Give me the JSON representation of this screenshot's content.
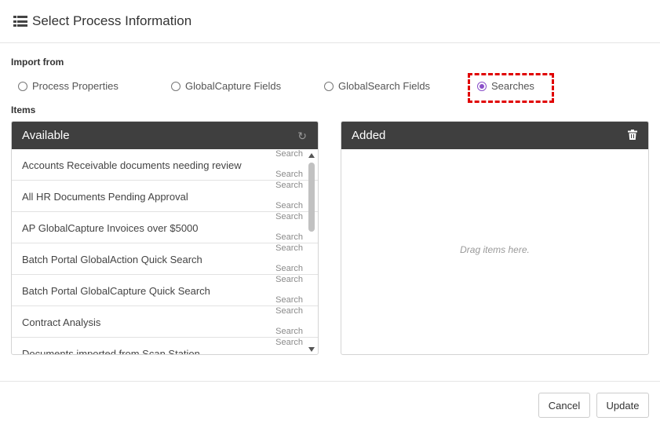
{
  "dialog": {
    "title": "Select Process Information",
    "icon": "list-icon"
  },
  "import_from": {
    "label": "Import from",
    "options": [
      {
        "label": "Process Properties",
        "selected": false
      },
      {
        "label": "GlobalCapture Fields",
        "selected": false
      },
      {
        "label": "GlobalSearch Fields",
        "selected": false
      },
      {
        "label": "Searches",
        "selected": true
      }
    ],
    "accent_color": "#8a4fc9",
    "highlight_color": "#e00000"
  },
  "items": {
    "label": "Items",
    "available": {
      "title": "Available",
      "tool_icon": "refresh-icon",
      "list": [
        {
          "name": "Accounts Receivable documents needing review",
          "type": "Search"
        },
        {
          "name": "All HR Documents Pending Approval",
          "type": "Search"
        },
        {
          "name": "AP GlobalCapture Invoices over $5000",
          "type": "Search"
        },
        {
          "name": "Batch Portal GlobalAction Quick Search",
          "type": "Search"
        },
        {
          "name": "Batch Portal GlobalCapture Quick Search",
          "type": "Search"
        },
        {
          "name": "Contract Analysis",
          "type": "Search"
        },
        {
          "name": "Documents imported from Scan Station",
          "type": "Search"
        }
      ]
    },
    "added": {
      "title": "Added",
      "tool_icon": "trash-icon",
      "empty_hint": "Drag items here."
    }
  },
  "footer": {
    "cancel_label": "Cancel",
    "update_label": "Update"
  },
  "colors": {
    "panel_header": "#3f3f3f"
  }
}
